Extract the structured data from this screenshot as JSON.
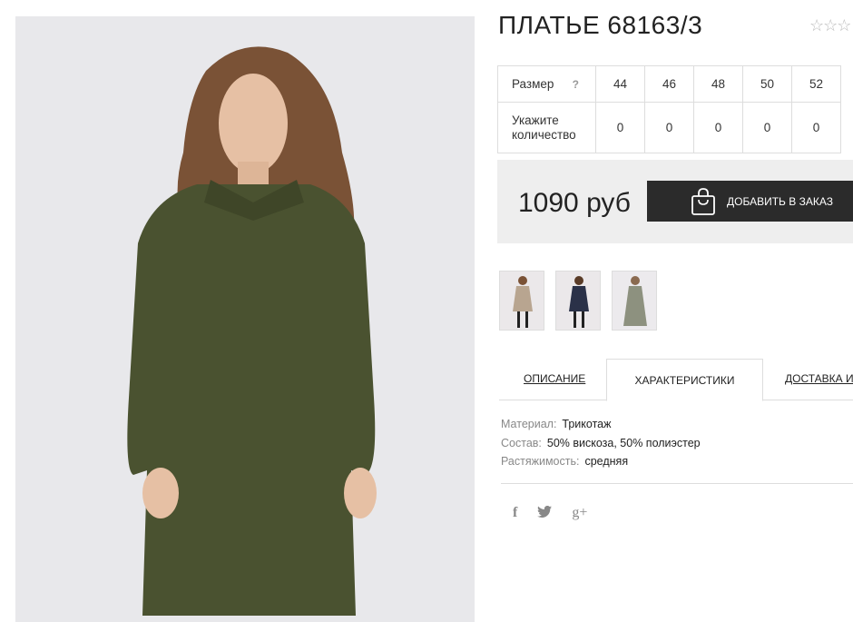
{
  "product": {
    "title": "ПЛАТЬЕ 68163/3",
    "rating_icon": "star-outline-icon",
    "stars": "☆☆☆",
    "price": "1090 руб",
    "add_button_label": "ДОБАВИТЬ В ЗАКАЗ"
  },
  "sizes_table": {
    "size_label": "Размер",
    "help_mark": "?",
    "qty_label_1": "Укажите",
    "qty_label_2": "количество",
    "sizes": [
      "44",
      "46",
      "48",
      "50",
      "52"
    ],
    "quantities": [
      "0",
      "0",
      "0",
      "0",
      "0"
    ]
  },
  "tabs": [
    "ОПИСАНИЕ",
    "ХАРАКТЕРИСТИКИ",
    "ДОСТАВКА И"
  ],
  "properties": [
    {
      "key": "Материал:",
      "value": "Трикотаж"
    },
    {
      "key": "Состав:",
      "value": "50% вискоза, 50% полиэстер"
    },
    {
      "key": "Растяжимость:",
      "value": "средняя"
    }
  ],
  "social": {
    "facebook": "f",
    "twitter": "🐦",
    "gplus": "g+"
  },
  "colors": {
    "dress_green": "#4a5230",
    "button_dark": "#2b2b2b",
    "price_bg": "#eeeeee"
  }
}
